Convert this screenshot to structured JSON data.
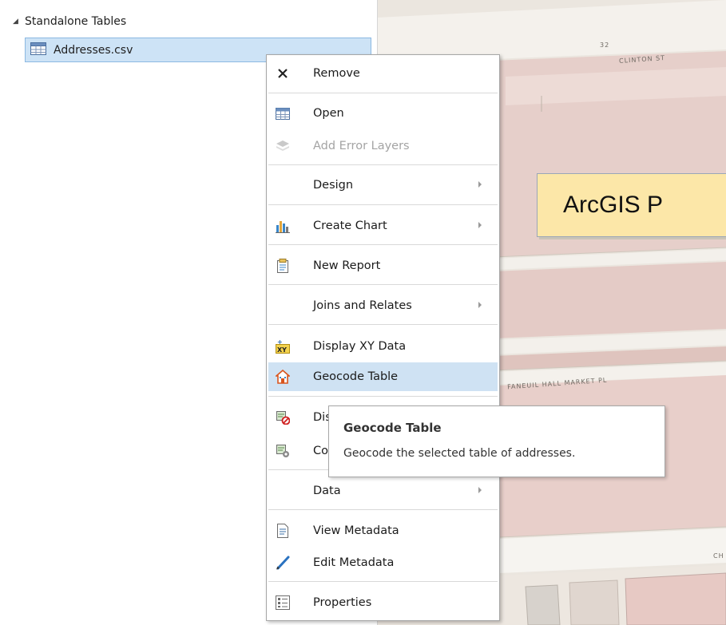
{
  "contents": {
    "group_label": "Standalone Tables",
    "table_item": "Addresses.csv"
  },
  "map": {
    "streets": {
      "number": "32",
      "clinton": "CLINTON ST",
      "faneuil": "FANEUIL HALL MARKET PL",
      "partial": "CH"
    }
  },
  "banner": {
    "text": "ArcGIS P"
  },
  "context_menu": {
    "items": [
      {
        "label": "Remove",
        "icon": "close-icon"
      },
      {
        "label": "Open",
        "icon": "table-icon"
      },
      {
        "label": "Add Error Layers",
        "icon": "layers-icon",
        "disabled": true
      },
      {
        "label": "Design",
        "submenu": true
      },
      {
        "label": "Create Chart",
        "icon": "bar-chart-icon",
        "submenu": true
      },
      {
        "label": "New Report",
        "icon": "report-icon"
      },
      {
        "label": "Joins and Relates",
        "submenu": true
      },
      {
        "label": "Display XY Data",
        "icon": "xy-icon"
      },
      {
        "label": "Geocode Table",
        "icon": "geocode-house-icon",
        "highlighted": true
      },
      {
        "label": "Dis",
        "icon": "disable-icon"
      },
      {
        "label": "Co",
        "icon": "configure-icon"
      },
      {
        "label": "Data",
        "submenu": true
      },
      {
        "label": "View Metadata",
        "icon": "metadata-icon"
      },
      {
        "label": "Edit Metadata",
        "icon": "pencil-icon"
      },
      {
        "label": "Properties",
        "icon": "properties-icon"
      }
    ]
  },
  "tooltip": {
    "title": "Geocode Table",
    "description": "Geocode the selected table of addresses."
  },
  "colors": {
    "selection_fill": "#cde3f6",
    "menu_highlight": "#cfe2f3",
    "banner_fill": "#fce7a8",
    "map_background": "#ebe6df"
  }
}
